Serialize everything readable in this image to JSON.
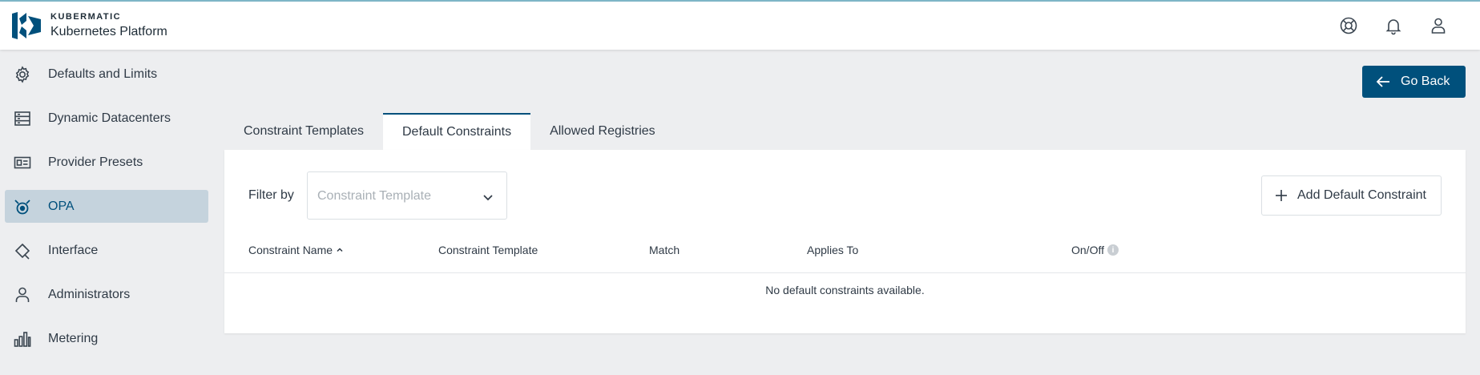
{
  "brand": {
    "company": "KUBERMATIC",
    "product": "Kubernetes Platform"
  },
  "header": {
    "icons": [
      "help-icon",
      "notifications-icon",
      "account-icon"
    ]
  },
  "sidebar": {
    "items": [
      {
        "label": "Defaults and Limits",
        "icon": "gear-icon",
        "active": false
      },
      {
        "label": "Dynamic Datacenters",
        "icon": "datacenter-list-icon",
        "active": false
      },
      {
        "label": "Provider Presets",
        "icon": "preset-card-icon",
        "active": false
      },
      {
        "label": "OPA",
        "icon": "opa-icon",
        "active": true
      },
      {
        "label": "Interface",
        "icon": "interface-icon",
        "active": false
      },
      {
        "label": "Administrators",
        "icon": "person-icon",
        "active": false
      },
      {
        "label": "Metering",
        "icon": "bar-chart-icon",
        "active": false
      }
    ]
  },
  "actions": {
    "go_back": "Go Back"
  },
  "tabs": [
    {
      "label": "Constraint Templates",
      "active": false
    },
    {
      "label": "Default Constraints",
      "active": true
    },
    {
      "label": "Allowed Registries",
      "active": false
    }
  ],
  "filter": {
    "label": "Filter by",
    "placeholder": "Constraint Template"
  },
  "add_button": {
    "label": "Add Default Constraint"
  },
  "table": {
    "columns": [
      "Constraint Name",
      "Constraint Template",
      "Match",
      "Applies To",
      "On/Off"
    ],
    "sort_column": "Constraint Name",
    "empty_message": "No default constraints available.",
    "info_glyph": "i"
  },
  "colors": {
    "primary": "#00507c",
    "active_nav_bg": "#c5d3dd",
    "page_bg": "#edeef0",
    "top_accent": "#7fb7c9"
  }
}
